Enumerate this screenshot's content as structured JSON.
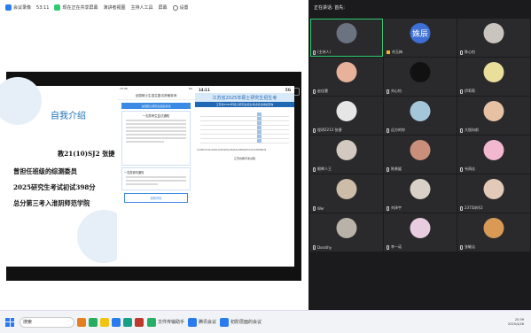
{
  "topbar": {
    "app_name": "会议录像",
    "time": "53:11",
    "title": "现在正在共享屏幕",
    "gallery": "演讲者视图",
    "account": "主持人工具",
    "screen": "屏幕",
    "settings": "设置"
  },
  "slide": {
    "title": "自我介绍",
    "lines": [
      "教21(10)SJ2 张捷",
      "曾担任班级的综测委员",
      "2025研究生考试初试398分",
      "总分第三考入淮阴师范学院"
    ]
  },
  "phone1": {
    "status_left": "10:46",
    "status_right": "5G",
    "header": "全国硕士生招生复试资格查询",
    "banner": "全国硕士研究生招生考试",
    "card_title": "一志愿考生复试通知",
    "card2_title": "一志愿调剂通知",
    "button": "查看详情"
  },
  "phone2": {
    "status_left": "14:11",
    "status_right": "5G",
    "banner": "江苏省2025年硕士研究生招生考",
    "sub": "江苏省2025年硕士研究生招生考试初试成绩查询",
    "url": "1d4f8c0ca5cd6bbde3f2ef5acf9eb2ed0f6e9f7de5c2fd6f96d3",
    "footer": "江苏省教育考试院"
  },
  "right_panel": {
    "header": "正在讲话: 首先:"
  },
  "participants": [
    {
      "name": "(主持人)",
      "avatar": "photo",
      "color": "#6b7280",
      "active": true
    },
    {
      "name": "刘玉梅",
      "avatar": "letter",
      "letter": "姝辰",
      "color": "#3d6fd6"
    },
    {
      "name": "陈心怡",
      "avatar": "photo",
      "color": "#c9c4bd"
    },
    {
      "name": "赵佳慧",
      "avatar": "photo",
      "color": "#e7b19a"
    },
    {
      "name": "刘心怡",
      "avatar": "photo",
      "color": "#111111"
    },
    {
      "name": "伊莉莉",
      "avatar": "photo",
      "color": "#e9df9b"
    },
    {
      "name": "程玥2213 张捷",
      "avatar": "photo",
      "color": "#e6e6e6"
    },
    {
      "name": "远方的你",
      "avatar": "photo",
      "color": "#a3c6d9"
    },
    {
      "name": "大胆向前",
      "avatar": "photo",
      "color": "#e6c1a3"
    },
    {
      "name": "眼眸人王",
      "avatar": "photo",
      "color": "#d4c9c0"
    },
    {
      "name": "陈勇媛",
      "avatar": "photo",
      "color": "#c98f7a"
    },
    {
      "name": "韦雨佳",
      "avatar": "photo",
      "color": "#f2b8cf"
    },
    {
      "name": "Wer",
      "avatar": "photo",
      "color": "#cdbca8"
    },
    {
      "name": "刘泽宇",
      "avatar": "photo",
      "color": "#d9d1c8"
    },
    {
      "name": "2375琼玲2",
      "avatar": "photo",
      "color": "#e2c9b8"
    },
    {
      "name": "Dorothy",
      "avatar": "photo",
      "color": "#b9b2a9"
    },
    {
      "name": "李一诺",
      "avatar": "photo",
      "color": "#e8cce0"
    },
    {
      "name": "张敏洁",
      "avatar": "photo",
      "color": "#d89a55"
    }
  ],
  "taskbar": {
    "search": "搜索",
    "apps": [
      {
        "name": "文件传输助手",
        "color": "#2aae67"
      },
      {
        "name": "腾讯会议",
        "color": "#2b7bf0"
      },
      {
        "name": "初阶层面的会议",
        "color": "#2b7bf0"
      }
    ],
    "clock_time": "20:39",
    "clock_date": "2025/4/26"
  }
}
